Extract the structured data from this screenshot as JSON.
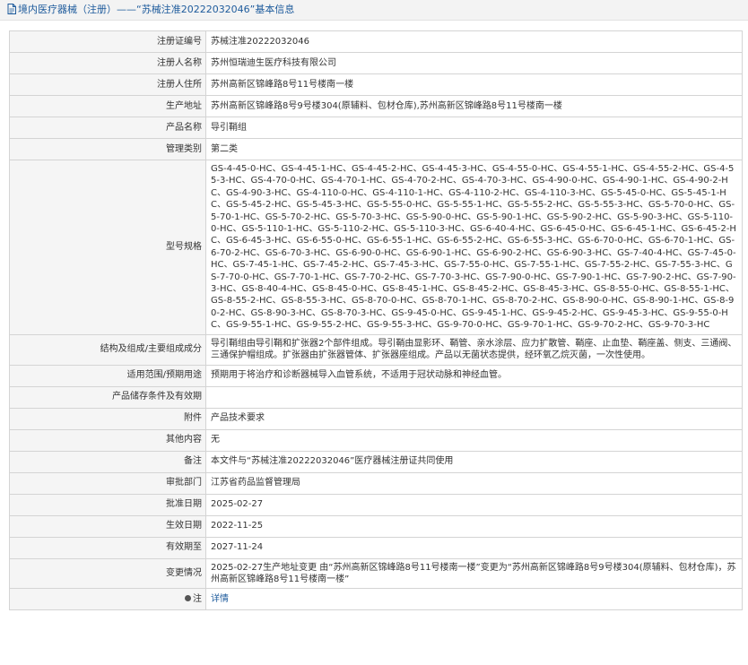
{
  "header": {
    "title": "境内医疗器械（注册）——“苏械注准20222032046”基本信息",
    "icon": "document-icon"
  },
  "fields": {
    "reg_no": {
      "label": "注册证编号",
      "value": "苏械注准20222032046"
    },
    "registrant": {
      "label": "注册人名称",
      "value": "苏州恒瑞迪生医疗科技有限公司"
    },
    "reg_address": {
      "label": "注册人住所",
      "value": "苏州高新区锦峰路8号11号楼南一楼"
    },
    "prod_address": {
      "label": "生产地址",
      "value": "苏州高新区锦峰路8号9号楼304(原辅料、包材仓库),苏州高新区锦峰路8号11号楼南一楼"
    },
    "product_name": {
      "label": "产品名称",
      "value": "导引鞘组"
    },
    "category": {
      "label": "管理类别",
      "value": "第二类"
    },
    "models": {
      "label": "型号规格",
      "value": "GS-4-45-0-HC、GS-4-45-1-HC、GS-4-45-2-HC、GS-4-45-3-HC、GS-4-55-0-HC、GS-4-55-1-HC、GS-4-55-2-HC、GS-4-55-3-HC、GS-4-70-0-HC、GS-4-70-1-HC、GS-4-70-2-HC、GS-4-70-3-HC、GS-4-90-0-HC、GS-4-90-1-HC、GS-4-90-2-HC、GS-4-90-3-HC、GS-4-110-0-HC、GS-4-110-1-HC、GS-4-110-2-HC、GS-4-110-3-HC、GS-5-45-0-HC、GS-5-45-1-HC、GS-5-45-2-HC、GS-5-45-3-HC、GS-5-55-0-HC、GS-5-55-1-HC、GS-5-55-2-HC、GS-5-55-3-HC、GS-5-70-0-HC、GS-5-70-1-HC、GS-5-70-2-HC、GS-5-70-3-HC、GS-5-90-0-HC、GS-5-90-1-HC、GS-5-90-2-HC、GS-5-90-3-HC、GS-5-110-0-HC、GS-5-110-1-HC、GS-5-110-2-HC、GS-5-110-3-HC、GS-6-40-4-HC、GS-6-45-0-HC、GS-6-45-1-HC、GS-6-45-2-HC、GS-6-45-3-HC、GS-6-55-0-HC、GS-6-55-1-HC、GS-6-55-2-HC、GS-6-55-3-HC、GS-6-70-0-HC、GS-6-70-1-HC、GS-6-70-2-HC、GS-6-70-3-HC、GS-6-90-0-HC、GS-6-90-1-HC、GS-6-90-2-HC、GS-6-90-3-HC、GS-7-40-4-HC、GS-7-45-0-HC、GS-7-45-1-HC、GS-7-45-2-HC、GS-7-45-3-HC、GS-7-55-0-HC、GS-7-55-1-HC、GS-7-55-2-HC、GS-7-55-3-HC、GS-7-70-0-HC、GS-7-70-1-HC、GS-7-70-2-HC、GS-7-70-3-HC、GS-7-90-0-HC、GS-7-90-1-HC、GS-7-90-2-HC、GS-7-90-3-HC、GS-8-40-4-HC、GS-8-45-0-HC、GS-8-45-1-HC、GS-8-45-2-HC、GS-8-45-3-HC、GS-8-55-0-HC、GS-8-55-1-HC、GS-8-55-2-HC、GS-8-55-3-HC、GS-8-70-0-HC、GS-8-70-1-HC、GS-8-70-2-HC、GS-8-90-0-HC、GS-8-90-1-HC、GS-8-90-2-HC、GS-8-90-3-HC、GS-8-70-3-HC、GS-9-45-0-HC、GS-9-45-1-HC、GS-9-45-2-HC、GS-9-45-3-HC、GS-9-55-0-HC、GS-9-55-1-HC、GS-9-55-2-HC、GS-9-55-3-HC、GS-9-70-0-HC、GS-9-70-1-HC、GS-9-70-2-HC、GS-9-70-3-HC"
    },
    "structure": {
      "label": "结构及组成/主要组成成分",
      "value": "导引鞘组由导引鞘和扩张器2个部件组成。导引鞘由显影环、鞘管、亲水涂层、应力扩散管、鞘座、止血垫、鞘座盖、侧支、三通阀、三通保护帽组成。扩张器由扩张器管体、扩张器座组成。产品以无菌状态提供，经环氧乙烷灭菌，一次性使用。"
    },
    "intended_use": {
      "label": "适用范围/预期用途",
      "value": "预期用于将治疗和诊断器械导入血管系统，不适用于冠状动脉和神经血管。"
    },
    "storage": {
      "label": "产品储存条件及有效期",
      "value": ""
    },
    "attachment": {
      "label": "附件",
      "value": "产品技术要求"
    },
    "other": {
      "label": "其他内容",
      "value": "无"
    },
    "remark": {
      "label": "备注",
      "value": "本文件与“苏械注准20222032046”医疗器械注册证共同使用"
    },
    "approver": {
      "label": "审批部门",
      "value": "江苏省药品监督管理局"
    },
    "approval_date": {
      "label": "批准日期",
      "value": "2025-02-27"
    },
    "effective_date": {
      "label": "生效日期",
      "value": "2022-11-25"
    },
    "expiry_date": {
      "label": "有效期至",
      "value": "2027-11-24"
    },
    "changes": {
      "label": "变更情况",
      "value": "2025-02-27生产地址变更 由“苏州高新区锦峰路8号11号楼南一楼”变更为“苏州高新区锦峰路8号9号楼304(原辅料、包材仓库)，苏州高新区锦峰路8号11号楼南一楼”"
    },
    "note": {
      "label": "注",
      "value": "详情",
      "icon": "bullet-icon"
    }
  }
}
